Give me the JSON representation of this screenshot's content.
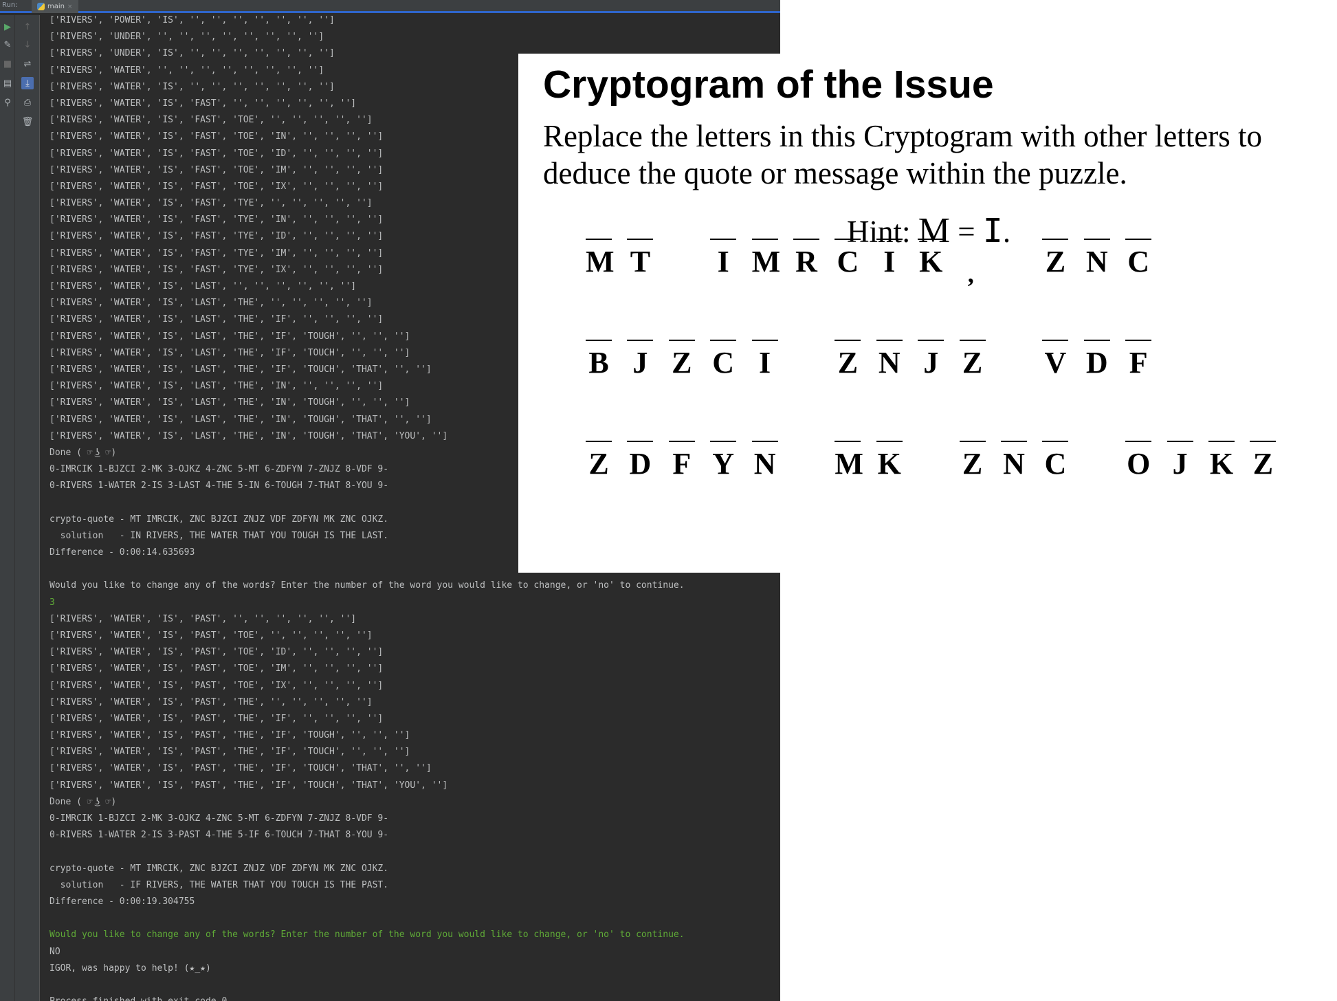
{
  "ide": {
    "run_label": "Run:",
    "tab_label": "main",
    "tab_close": "×",
    "console_lines": [
      "['RIVERS', 'POWER', 'IS', '', '', '', '', '', '', '']",
      "['RIVERS', 'UNDER', '', '', '', '', '', '', '', '']",
      "['RIVERS', 'UNDER', 'IS', '', '', '', '', '', '', '']",
      "['RIVERS', 'WATER', '', '', '', '', '', '', '', '']",
      "['RIVERS', 'WATER', 'IS', '', '', '', '', '', '', '']",
      "['RIVERS', 'WATER', 'IS', 'FAST', '', '', '', '', '', '']",
      "['RIVERS', 'WATER', 'IS', 'FAST', 'TOE', '', '', '', '', '']",
      "['RIVERS', 'WATER', 'IS', 'FAST', 'TOE', 'IN', '', '', '', '']",
      "['RIVERS', 'WATER', 'IS', 'FAST', 'TOE', 'ID', '', '', '', '']",
      "['RIVERS', 'WATER', 'IS', 'FAST', 'TOE', 'IM', '', '', '', '']",
      "['RIVERS', 'WATER', 'IS', 'FAST', 'TOE', 'IX', '', '', '', '']",
      "['RIVERS', 'WATER', 'IS', 'FAST', 'TYE', '', '', '', '', '']",
      "['RIVERS', 'WATER', 'IS', 'FAST', 'TYE', 'IN', '', '', '', '']",
      "['RIVERS', 'WATER', 'IS', 'FAST', 'TYE', 'ID', '', '', '', '']",
      "['RIVERS', 'WATER', 'IS', 'FAST', 'TYE', 'IM', '', '', '', '']",
      "['RIVERS', 'WATER', 'IS', 'FAST', 'TYE', 'IX', '', '', '', '']",
      "['RIVERS', 'WATER', 'IS', 'LAST', '', '', '', '', '', '']",
      "['RIVERS', 'WATER', 'IS', 'LAST', 'THE', '', '', '', '', '']",
      "['RIVERS', 'WATER', 'IS', 'LAST', 'THE', 'IF', '', '', '', '']",
      "['RIVERS', 'WATER', 'IS', 'LAST', 'THE', 'IF', 'TOUGH', '', '', '']",
      "['RIVERS', 'WATER', 'IS', 'LAST', 'THE', 'IF', 'TOUCH', '', '', '']",
      "['RIVERS', 'WATER', 'IS', 'LAST', 'THE', 'IF', 'TOUCH', 'THAT', '', '']",
      "['RIVERS', 'WATER', 'IS', 'LAST', 'THE', 'IN', '', '', '', '']",
      "['RIVERS', 'WATER', 'IS', 'LAST', 'THE', 'IN', 'TOUGH', '', '', '']",
      "['RIVERS', 'WATER', 'IS', 'LAST', 'THE', 'IN', 'TOUGH', 'THAT', '', '']",
      "['RIVERS', 'WATER', 'IS', 'LAST', 'THE', 'IN', 'TOUGH', 'THAT', 'YOU', '']",
      "Done ( ☞ ͜ʖ ☞)",
      "0-IMRCIK 1-BJZCI 2-MK 3-OJKZ 4-ZNC 5-MT 6-ZDFYN 7-ZNJZ 8-VDF 9-",
      "0-RIVERS 1-WATER 2-IS 3-LAST 4-THE 5-IN 6-TOUGH 7-THAT 8-YOU 9-",
      "",
      "crypto-quote - MT IMRCIK, ZNC BJZCI ZNJZ VDF ZDFYN MK ZNC OJKZ.",
      "  solution   - IN RIVERS, THE WATER THAT YOU TOUGH IS THE LAST.",
      "Difference - 0:00:14.635693",
      "",
      "Would you like to change any of the words? Enter the number of the word you would like to change, or 'no' to continue.",
      "3",
      "['RIVERS', 'WATER', 'IS', 'PAST', '', '', '', '', '', '']",
      "['RIVERS', 'WATER', 'IS', 'PAST', 'TOE', '', '', '', '', '']",
      "['RIVERS', 'WATER', 'IS', 'PAST', 'TOE', 'ID', '', '', '', '']",
      "['RIVERS', 'WATER', 'IS', 'PAST', 'TOE', 'IM', '', '', '', '']",
      "['RIVERS', 'WATER', 'IS', 'PAST', 'TOE', 'IX', '', '', '', '']",
      "['RIVERS', 'WATER', 'IS', 'PAST', 'THE', '', '', '', '', '']",
      "['RIVERS', 'WATER', 'IS', 'PAST', 'THE', 'IF', '', '', '', '']",
      "['RIVERS', 'WATER', 'IS', 'PAST', 'THE', 'IF', 'TOUGH', '', '', '']",
      "['RIVERS', 'WATER', 'IS', 'PAST', 'THE', 'IF', 'TOUCH', '', '', '']",
      "['RIVERS', 'WATER', 'IS', 'PAST', 'THE', 'IF', 'TOUCH', 'THAT', '', '']",
      "['RIVERS', 'WATER', 'IS', 'PAST', 'THE', 'IF', 'TOUCH', 'THAT', 'YOU', '']",
      "Done ( ☞ ͜ʖ ☞)",
      "0-IMRCIK 1-BJZCI 2-MK 3-OJKZ 4-ZNC 5-MT 6-ZDFYN 7-ZNJZ 8-VDF 9-",
      "0-RIVERS 1-WATER 2-IS 3-PAST 4-THE 5-IF 6-TOUCH 7-THAT 8-YOU 9-",
      "",
      "crypto-quote - MT IMRCIK, ZNC BJZCI ZNJZ VDF ZDFYN MK ZNC OJKZ.",
      "  solution   - IF RIVERS, THE WATER THAT YOU TOUCH IS THE PAST.",
      "Difference - 0:00:19.304755",
      "",
      "Would you like to change any of the words? Enter the number of the word you would like to change, or 'no' to continue.",
      "NO",
      "IGOR, was happy to help! (★_★)",
      "",
      "Process finished with exit code 0"
    ],
    "input_line_indices": [
      35,
      55
    ]
  },
  "puzzle": {
    "title": "Cryptogram of the Issue",
    "instructions": "Replace the letters in this Cryptogram with other letters to deduce the quote or message within the puzzle.",
    "hint_prefix": "Hint: ",
    "hint_cipher": "M",
    "hint_equals": " = ",
    "hint_plain": "I",
    "hint_suffix": ".",
    "apostrophe": "’",
    "rows": [
      [
        "M",
        "T",
        "",
        "I",
        "M",
        "R",
        "C",
        "I",
        "K",
        "",
        "",
        "Z",
        "N",
        "C"
      ],
      [
        "B",
        "J",
        "Z",
        "C",
        "I",
        "",
        "Z",
        "N",
        "J",
        "Z",
        "",
        "V",
        "D",
        "F"
      ],
      [
        "Z",
        "D",
        "F",
        "Y",
        "N",
        "",
        "M",
        "K",
        "",
        "Z",
        "N",
        "C",
        "",
        "O",
        "J",
        "K",
        "Z"
      ]
    ]
  }
}
